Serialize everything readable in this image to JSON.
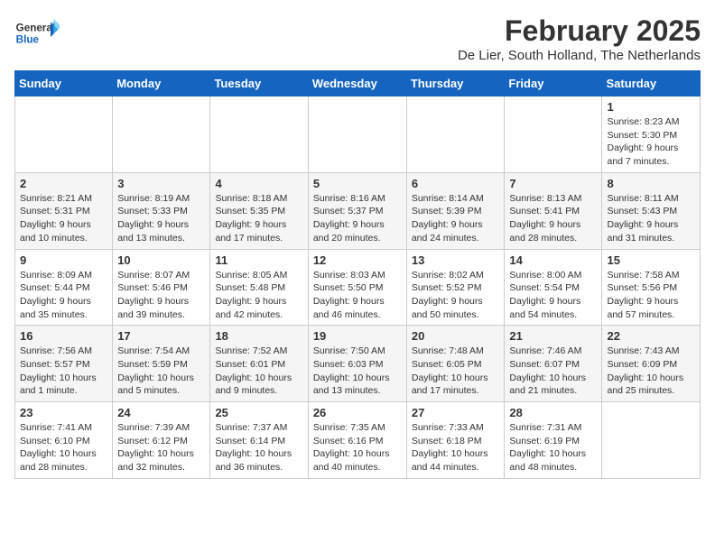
{
  "header": {
    "logo_general": "General",
    "logo_blue": "Blue",
    "title": "February 2025",
    "subtitle": "De Lier, South Holland, The Netherlands"
  },
  "weekdays": [
    "Sunday",
    "Monday",
    "Tuesday",
    "Wednesday",
    "Thursday",
    "Friday",
    "Saturday"
  ],
  "weeks": [
    [
      {
        "day": "",
        "info": ""
      },
      {
        "day": "",
        "info": ""
      },
      {
        "day": "",
        "info": ""
      },
      {
        "day": "",
        "info": ""
      },
      {
        "day": "",
        "info": ""
      },
      {
        "day": "",
        "info": ""
      },
      {
        "day": "1",
        "info": "Sunrise: 8:23 AM\nSunset: 5:30 PM\nDaylight: 9 hours and 7 minutes."
      }
    ],
    [
      {
        "day": "2",
        "info": "Sunrise: 8:21 AM\nSunset: 5:31 PM\nDaylight: 9 hours and 10 minutes."
      },
      {
        "day": "3",
        "info": "Sunrise: 8:19 AM\nSunset: 5:33 PM\nDaylight: 9 hours and 13 minutes."
      },
      {
        "day": "4",
        "info": "Sunrise: 8:18 AM\nSunset: 5:35 PM\nDaylight: 9 hours and 17 minutes."
      },
      {
        "day": "5",
        "info": "Sunrise: 8:16 AM\nSunset: 5:37 PM\nDaylight: 9 hours and 20 minutes."
      },
      {
        "day": "6",
        "info": "Sunrise: 8:14 AM\nSunset: 5:39 PM\nDaylight: 9 hours and 24 minutes."
      },
      {
        "day": "7",
        "info": "Sunrise: 8:13 AM\nSunset: 5:41 PM\nDaylight: 9 hours and 28 minutes."
      },
      {
        "day": "8",
        "info": "Sunrise: 8:11 AM\nSunset: 5:43 PM\nDaylight: 9 hours and 31 minutes."
      }
    ],
    [
      {
        "day": "9",
        "info": "Sunrise: 8:09 AM\nSunset: 5:44 PM\nDaylight: 9 hours and 35 minutes."
      },
      {
        "day": "10",
        "info": "Sunrise: 8:07 AM\nSunset: 5:46 PM\nDaylight: 9 hours and 39 minutes."
      },
      {
        "day": "11",
        "info": "Sunrise: 8:05 AM\nSunset: 5:48 PM\nDaylight: 9 hours and 42 minutes."
      },
      {
        "day": "12",
        "info": "Sunrise: 8:03 AM\nSunset: 5:50 PM\nDaylight: 9 hours and 46 minutes."
      },
      {
        "day": "13",
        "info": "Sunrise: 8:02 AM\nSunset: 5:52 PM\nDaylight: 9 hours and 50 minutes."
      },
      {
        "day": "14",
        "info": "Sunrise: 8:00 AM\nSunset: 5:54 PM\nDaylight: 9 hours and 54 minutes."
      },
      {
        "day": "15",
        "info": "Sunrise: 7:58 AM\nSunset: 5:56 PM\nDaylight: 9 hours and 57 minutes."
      }
    ],
    [
      {
        "day": "16",
        "info": "Sunrise: 7:56 AM\nSunset: 5:57 PM\nDaylight: 10 hours and 1 minute."
      },
      {
        "day": "17",
        "info": "Sunrise: 7:54 AM\nSunset: 5:59 PM\nDaylight: 10 hours and 5 minutes."
      },
      {
        "day": "18",
        "info": "Sunrise: 7:52 AM\nSunset: 6:01 PM\nDaylight: 10 hours and 9 minutes."
      },
      {
        "day": "19",
        "info": "Sunrise: 7:50 AM\nSunset: 6:03 PM\nDaylight: 10 hours and 13 minutes."
      },
      {
        "day": "20",
        "info": "Sunrise: 7:48 AM\nSunset: 6:05 PM\nDaylight: 10 hours and 17 minutes."
      },
      {
        "day": "21",
        "info": "Sunrise: 7:46 AM\nSunset: 6:07 PM\nDaylight: 10 hours and 21 minutes."
      },
      {
        "day": "22",
        "info": "Sunrise: 7:43 AM\nSunset: 6:09 PM\nDaylight: 10 hours and 25 minutes."
      }
    ],
    [
      {
        "day": "23",
        "info": "Sunrise: 7:41 AM\nSunset: 6:10 PM\nDaylight: 10 hours and 28 minutes."
      },
      {
        "day": "24",
        "info": "Sunrise: 7:39 AM\nSunset: 6:12 PM\nDaylight: 10 hours and 32 minutes."
      },
      {
        "day": "25",
        "info": "Sunrise: 7:37 AM\nSunset: 6:14 PM\nDaylight: 10 hours and 36 minutes."
      },
      {
        "day": "26",
        "info": "Sunrise: 7:35 AM\nSunset: 6:16 PM\nDaylight: 10 hours and 40 minutes."
      },
      {
        "day": "27",
        "info": "Sunrise: 7:33 AM\nSunset: 6:18 PM\nDaylight: 10 hours and 44 minutes."
      },
      {
        "day": "28",
        "info": "Sunrise: 7:31 AM\nSunset: 6:19 PM\nDaylight: 10 hours and 48 minutes."
      },
      {
        "day": "",
        "info": ""
      }
    ]
  ]
}
